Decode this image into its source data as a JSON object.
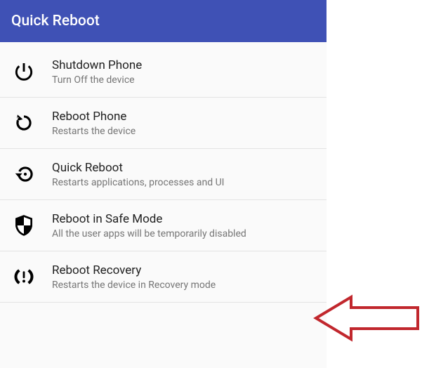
{
  "header": {
    "title": "Quick Reboot"
  },
  "items": [
    {
      "icon": "power-icon",
      "title": "Shutdown Phone",
      "subtitle": "Turn Off the device"
    },
    {
      "icon": "refresh-icon",
      "title": "Reboot Phone",
      "subtitle": "Restarts the device"
    },
    {
      "icon": "history-icon",
      "title": "Quick Reboot",
      "subtitle": "Restarts applications, processes and UI"
    },
    {
      "icon": "shield-icon",
      "title": "Reboot in Safe Mode",
      "subtitle": "All the user apps will be temporarily disabled"
    },
    {
      "icon": "recovery-icon",
      "title": "Reboot Recovery",
      "subtitle": "Restarts the device in Recovery mode"
    }
  ],
  "annotation": {
    "color": "#c1272d"
  }
}
